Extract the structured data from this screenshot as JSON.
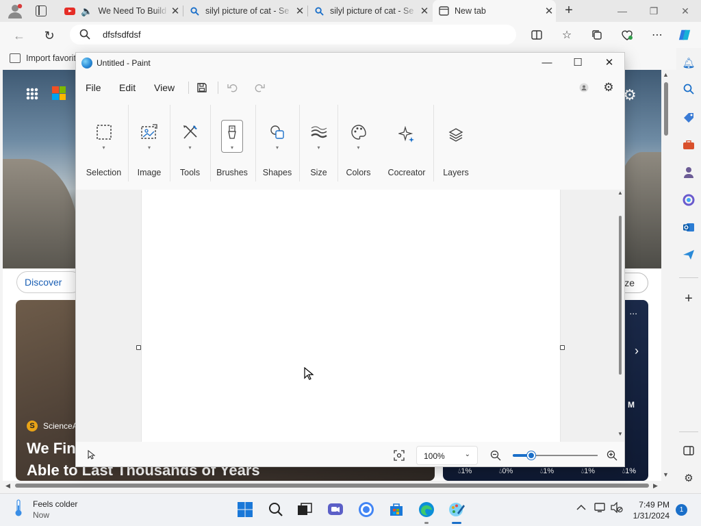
{
  "browser": {
    "tabs": [
      {
        "title": "We Need To Build",
        "favicon": "youtube-icon",
        "audio": true
      },
      {
        "title": "silyl picture of cat - Se",
        "favicon": "search-icon"
      },
      {
        "title": "silyl picture of cat - Se",
        "favicon": "search-icon"
      },
      {
        "title": "New tab",
        "favicon": "newtab-icon",
        "active": true
      }
    ],
    "address": "dfsfsdfdsf",
    "favorites_bar": {
      "import_label": "Import favorites"
    }
  },
  "page": {
    "discover_label": "Discover",
    "personalize_label": "lize",
    "news": {
      "source": "ScienceA",
      "headline_1": "We Fin",
      "headline_2": "Able to Last Thousands of Years"
    },
    "weather_card": {
      "dots": "...",
      "m_label": "M",
      "percentages": [
        "1%",
        "0%",
        "1%",
        "1%",
        "1%"
      ]
    }
  },
  "paint": {
    "title": "Untitled - Paint",
    "menu": {
      "file": "File",
      "edit": "Edit",
      "view": "View"
    },
    "ribbon": [
      {
        "label": "Selection",
        "icon": "selection-icon"
      },
      {
        "label": "Image",
        "icon": "image-icon"
      },
      {
        "label": "Tools",
        "icon": "tools-icon"
      },
      {
        "label": "Brushes",
        "icon": "brush-icon"
      },
      {
        "label": "Shapes",
        "icon": "shapes-icon"
      },
      {
        "label": "Size",
        "icon": "size-icon"
      },
      {
        "label": "Colors",
        "icon": "palette-icon"
      },
      {
        "label": "Cocreator",
        "icon": "sparkle-icon"
      },
      {
        "label": "Layers",
        "icon": "layers-icon"
      }
    ],
    "status": {
      "zoom": "100%",
      "zoom_level": 0.22
    }
  },
  "taskbar": {
    "weather": {
      "line1": "Feels colder",
      "line2": "Now"
    },
    "time": "7:49 PM",
    "date": "1/31/2024",
    "notifications": "1"
  },
  "colors": {
    "accent": "#1a6fc9",
    "youtube": "#e52d27"
  }
}
